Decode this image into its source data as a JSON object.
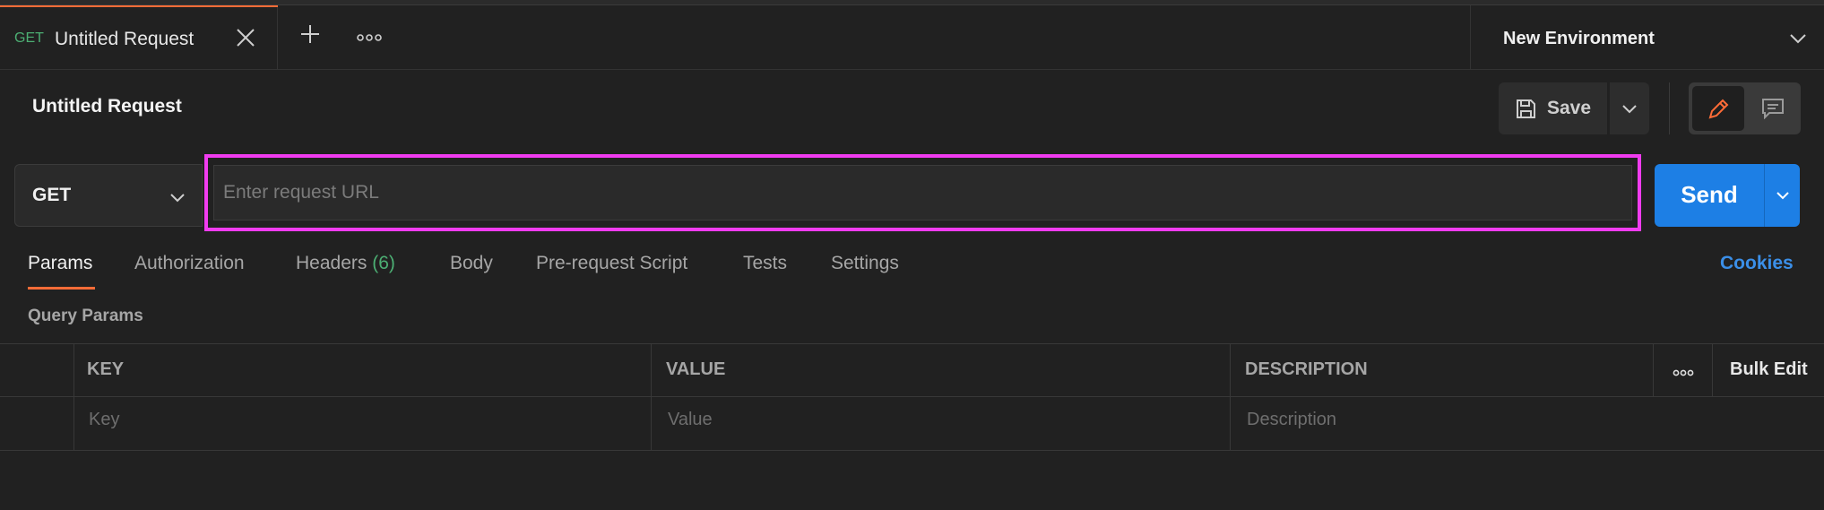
{
  "tab": {
    "method": "GET",
    "title": "Untitled Request"
  },
  "environment": {
    "label": "New Environment"
  },
  "request": {
    "title": "Untitled Request",
    "save_label": "Save"
  },
  "url_bar": {
    "method": "GET",
    "placeholder": "Enter request URL",
    "send_label": "Send"
  },
  "request_tabs": [
    {
      "label": "Params"
    },
    {
      "label": "Authorization"
    },
    {
      "label": "Headers",
      "count": "(6)"
    },
    {
      "label": "Body"
    },
    {
      "label": "Pre-request Script"
    },
    {
      "label": "Tests"
    },
    {
      "label": "Settings"
    }
  ],
  "cookies_label": "Cookies",
  "query_params": {
    "label": "Query Params",
    "columns": [
      "KEY",
      "VALUE",
      "DESCRIPTION"
    ],
    "placeholders": [
      "Key",
      "Value",
      "Description"
    ],
    "bulk_edit_label": "Bulk Edit"
  },
  "colors": {
    "accent": "#ff6c37",
    "send": "#1d7fe5",
    "method_get": "#4cae73",
    "highlight": "#f13cf0",
    "link": "#3b8fe8"
  }
}
